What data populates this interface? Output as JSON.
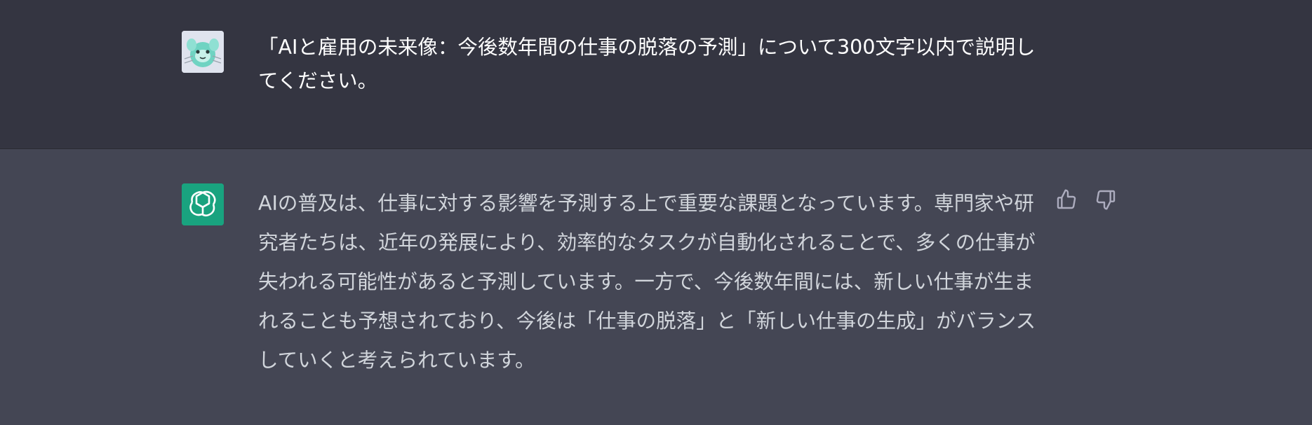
{
  "user_message": {
    "text": "「AIと雇用の未来像：今後数年間の仕事の脱落の予測」について300文字以内で説明してください。",
    "avatar_icon": "user-avatar"
  },
  "assistant_message": {
    "text": "AIの普及は、仕事に対する影響を予測する上で重要な課題となっています。専門家や研究者たちは、近年の発展により、効率的なタスクが自動化されることで、多くの仕事が失われる可能性があると予測しています。一方で、今後数年間には、新しい仕事が生まれることも予想されており、今後は「仕事の脱落」と「新しい仕事の生成」がバランスしていくと考えられています。",
    "avatar_icon": "openai-logo"
  },
  "feedback": {
    "thumbs_up_icon": "thumbs-up-icon",
    "thumbs_down_icon": "thumbs-down-icon"
  },
  "colors": {
    "user_bg": "#343541",
    "assistant_bg": "#444654",
    "assistant_avatar_bg": "#19a37f"
  }
}
